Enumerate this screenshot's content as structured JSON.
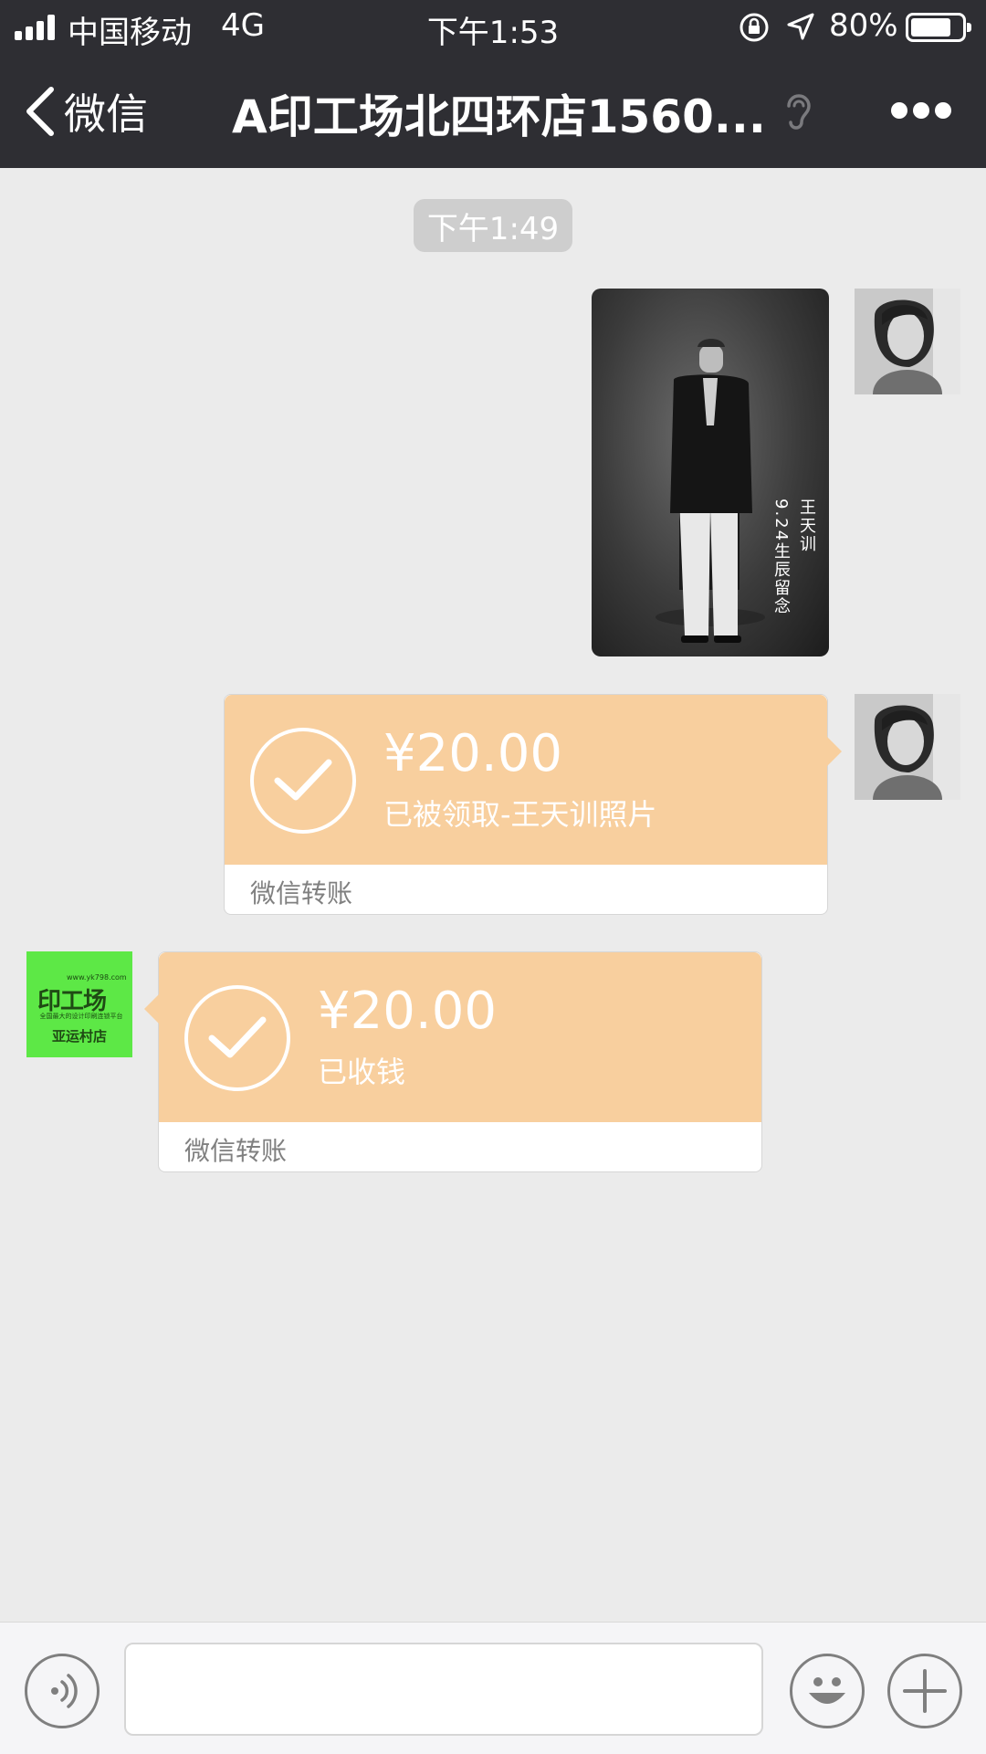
{
  "status_bar": {
    "carrier": "中国移动",
    "network": "4G",
    "time": "下午1:53",
    "battery": "80%",
    "battery_level": 0.8,
    "icons": [
      "signal-icon",
      "orientation-lock-icon",
      "location-arrow-icon",
      "battery-icon"
    ]
  },
  "nav": {
    "back_label": "微信",
    "title": "A印工场北四环店1560...",
    "icons": [
      "chevron-left-icon",
      "earpiece-icon",
      "more-icon"
    ]
  },
  "chat": {
    "time_divider": "下午1:49",
    "photo": {
      "caption_lines": [
        "王天训",
        "9.24生辰留念"
      ]
    },
    "sent_transfer": {
      "amount": "¥20.00",
      "status": "已被领取-王天训照片",
      "footer": "微信转账"
    },
    "received_transfer": {
      "amount": "¥20.00",
      "status": "已收钱",
      "footer": "微信转账"
    },
    "shop_avatar": {
      "url": "www.yk798.com",
      "brand": "印工场",
      "slogan": "全国最大的设计印刷连锁平台",
      "store": "亚运村店"
    }
  },
  "input_bar": {
    "text_value": "",
    "icons": [
      "voice-icon",
      "emoji-icon",
      "plus-icon"
    ]
  },
  "colors": {
    "topbar": "#2e2e33",
    "chat_background": "#ebebeb",
    "transfer_orange": "#f8cf9e",
    "shop_green": "#5de846"
  }
}
